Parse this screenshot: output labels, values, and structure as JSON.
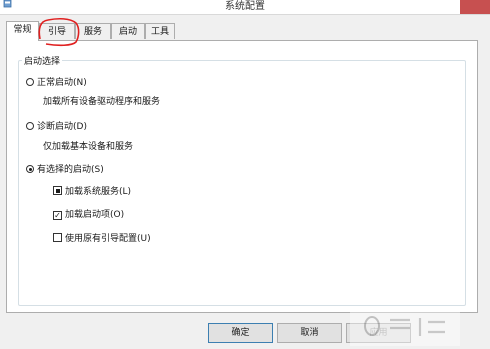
{
  "window": {
    "title": "系统配置"
  },
  "tabs": [
    {
      "label": "常规",
      "active": true
    },
    {
      "label": "引导",
      "active": false
    },
    {
      "label": "服务",
      "active": false
    },
    {
      "label": "启动",
      "active": false
    },
    {
      "label": "工具",
      "active": false
    }
  ],
  "startup": {
    "group_label": "启动选择",
    "normal": {
      "label": "正常启动(N)",
      "desc": "加载所有设备驱动程序和服务",
      "selected": false
    },
    "diagnostic": {
      "label": "诊断启动(D)",
      "desc": "仅加载基本设备和服务",
      "selected": false
    },
    "selective": {
      "label": "有选择的启动(S)",
      "selected": true,
      "load_system_services": {
        "label": "加载系统服务(L)",
        "state": "indeterminate"
      },
      "load_startup_items": {
        "label": "加载启动项(O)",
        "state": "checked"
      },
      "use_original_boot": {
        "label": "使用原有引导配置(U)",
        "state": "unchecked"
      }
    }
  },
  "buttons": {
    "ok": "确定",
    "cancel": "取消",
    "apply": "应用"
  },
  "colors": {
    "close_button": "#c75050",
    "annotation": "#e02020",
    "default_button_border": "#3c7fb1"
  },
  "icons": {
    "app": "system-config-icon",
    "close": "close-icon"
  }
}
